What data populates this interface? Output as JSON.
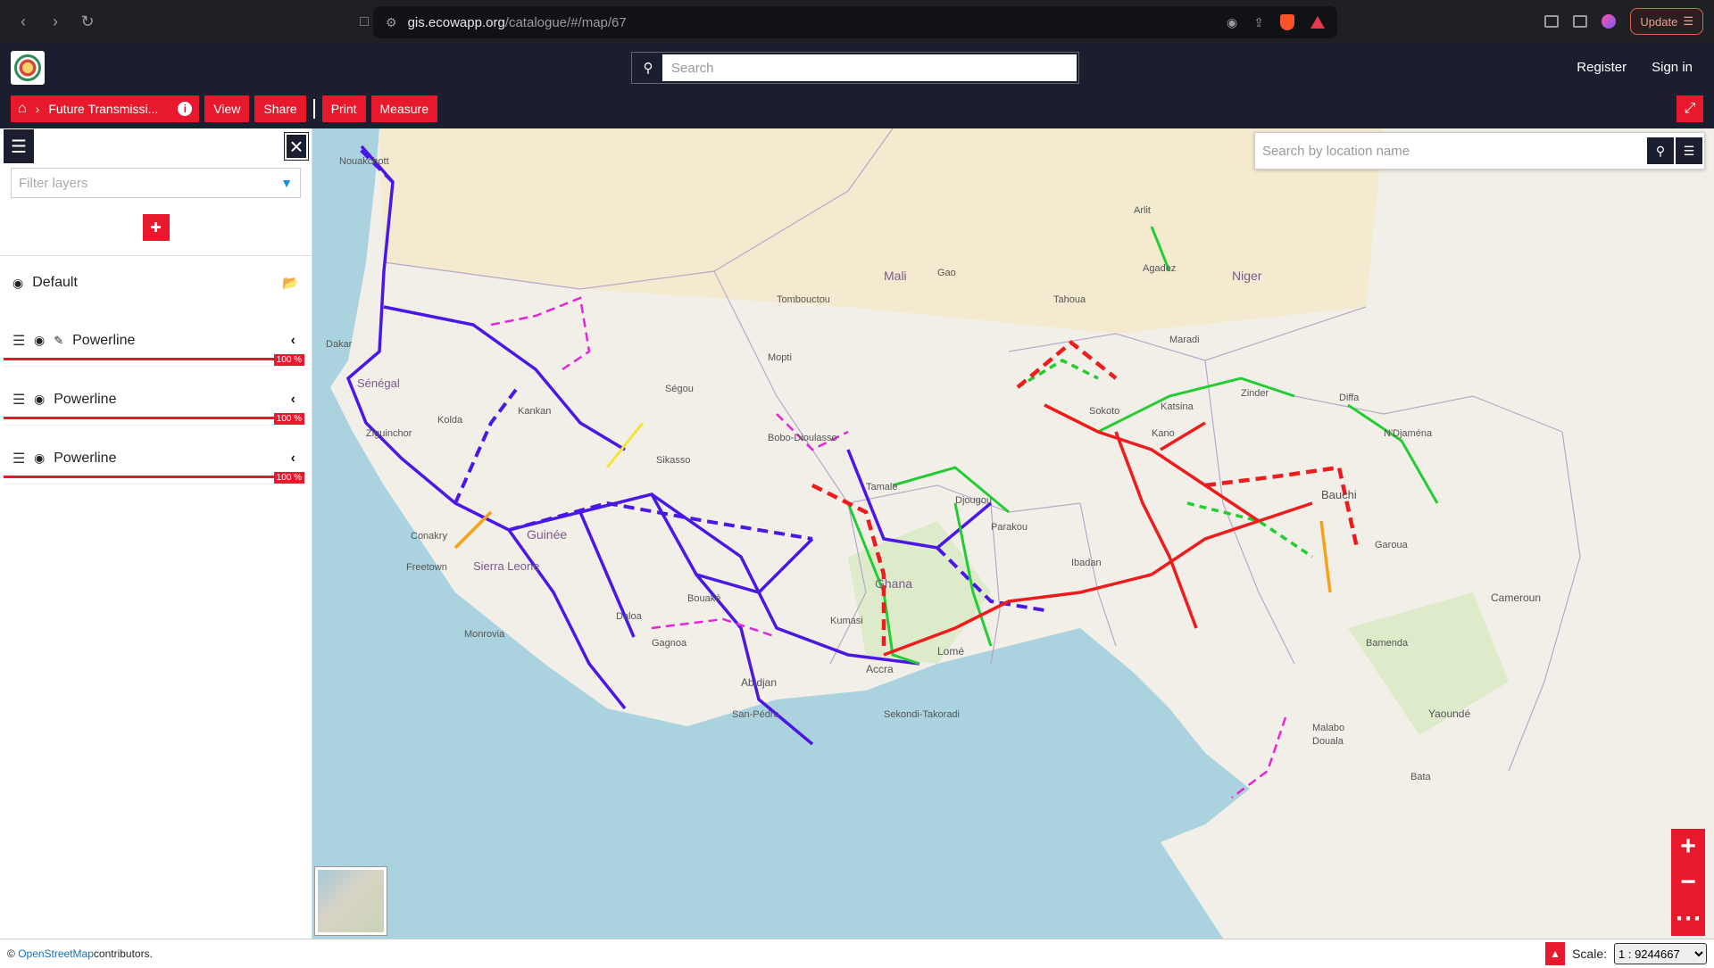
{
  "browser": {
    "url_host": "gis.ecowapp.org",
    "url_path": "/catalogue/#/map/67",
    "update_label": "Update"
  },
  "header": {
    "search_placeholder": "Search",
    "register": "Register",
    "sign_in": "Sign in"
  },
  "toolbar": {
    "map_title": "Future Transmissi...",
    "view": "View",
    "share": "Share",
    "print": "Print",
    "measure": "Measure"
  },
  "sidebar": {
    "filter_placeholder": "Filter layers",
    "group_name": "Default",
    "layers": [
      {
        "name": "Powerline",
        "opacity": "100 %"
      },
      {
        "name": "Powerline",
        "opacity": "100 %"
      },
      {
        "name": "Powerline",
        "opacity": "100 %"
      }
    ]
  },
  "map": {
    "location_placeholder": "Search by location name",
    "labels": [
      {
        "text": "Mali"
      },
      {
        "text": "Niger"
      },
      {
        "text": "Ghana"
      },
      {
        "text": "Sénégal"
      },
      {
        "text": "Guinée"
      },
      {
        "text": "Sierra Leone"
      },
      {
        "text": "Bauchi"
      },
      {
        "text": "Abidjan"
      },
      {
        "text": "Accra"
      },
      {
        "text": "Lomé"
      },
      {
        "text": "Conakry"
      },
      {
        "text": "Freetown"
      },
      {
        "text": "Monrovia"
      },
      {
        "text": "Dakar"
      },
      {
        "text": "Agadez"
      },
      {
        "text": "Arlit"
      },
      {
        "text": "Yaoundé"
      },
      {
        "text": "Douala"
      },
      {
        "text": "Bamenda"
      },
      {
        "text": "Sokoto"
      },
      {
        "text": "Katsina"
      },
      {
        "text": "Zinder"
      },
      {
        "text": "Diffa"
      },
      {
        "text": "N'Djaména"
      },
      {
        "text": "Garoua"
      },
      {
        "text": "Sekondi-Takoradi"
      },
      {
        "text": "San-Pédro"
      },
      {
        "text": "Kolda"
      },
      {
        "text": "Ziguinchor"
      },
      {
        "text": "Kankan"
      },
      {
        "text": "Sikasso"
      },
      {
        "text": "Ségou"
      },
      {
        "text": "Tombouctou"
      },
      {
        "text": "Gao"
      },
      {
        "text": "Tahoua"
      },
      {
        "text": "Maradi"
      },
      {
        "text": "Kano"
      },
      {
        "text": "Ibadan"
      },
      {
        "text": "Malabo"
      },
      {
        "text": "Bata"
      },
      {
        "text": "Cameroun"
      },
      {
        "text": "Nouakchott"
      },
      {
        "text": "Mopti"
      },
      {
        "text": "Bobo-Dioulasso"
      },
      {
        "text": "Djougou"
      },
      {
        "text": "Parakou"
      },
      {
        "text": "Tamale"
      },
      {
        "text": "Kumasi"
      },
      {
        "text": "Bouaké"
      },
      {
        "text": "Gagnoa"
      },
      {
        "text": "Daloa"
      }
    ]
  },
  "footer": {
    "osm": "OpenStreetMap",
    "contributors": " contributors.",
    "scale_label": "Scale:",
    "scale_value": "1 : 9244667"
  },
  "colors": {
    "accent": "#e8192c",
    "header_bg": "#1b1e2f",
    "line_blue": "#4a17e6",
    "line_red": "#ee1c1c",
    "line_green": "#22cc33",
    "line_magenta": "#e426d8"
  }
}
